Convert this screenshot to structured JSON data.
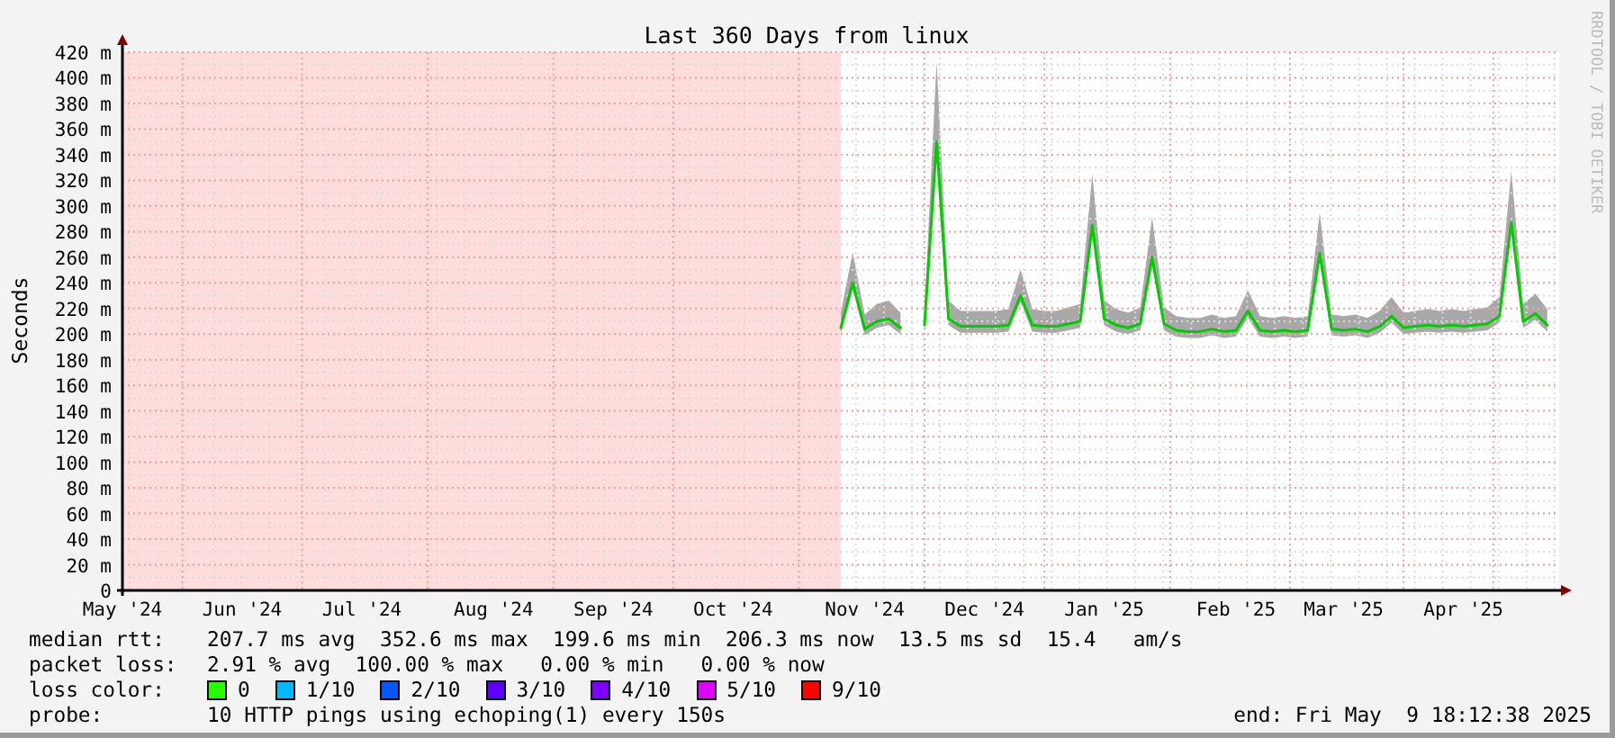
{
  "chart": {
    "watermark": "RRDTOOL / TOBI OETIKER",
    "chart_data": {
      "type": "line",
      "title": "Last 360 Days from linux",
      "ylabel": "Seconds",
      "ylim": [
        0,
        420
      ],
      "yticks": [
        {
          "value": 0,
          "label": "0"
        },
        {
          "value": 20,
          "label": "20 m"
        },
        {
          "value": 40,
          "label": "40 m"
        },
        {
          "value": 60,
          "label": "60 m"
        },
        {
          "value": 80,
          "label": "80 m"
        },
        {
          "value": 100,
          "label": "100 m"
        },
        {
          "value": 120,
          "label": "120 m"
        },
        {
          "value": 140,
          "label": "140 m"
        },
        {
          "value": 160,
          "label": "160 m"
        },
        {
          "value": 180,
          "label": "180 m"
        },
        {
          "value": 200,
          "label": "200 m"
        },
        {
          "value": 220,
          "label": "220 m"
        },
        {
          "value": 240,
          "label": "240 m"
        },
        {
          "value": 260,
          "label": "260 m"
        },
        {
          "value": 280,
          "label": "280 m"
        },
        {
          "value": 300,
          "label": "300 m"
        },
        {
          "value": 320,
          "label": "320 m"
        },
        {
          "value": 340,
          "label": "340 m"
        },
        {
          "value": 360,
          "label": "360 m"
        },
        {
          "value": 380,
          "label": "380 m"
        },
        {
          "value": 400,
          "label": "400 m"
        },
        {
          "value": 420,
          "label": "420 m"
        }
      ],
      "grid": true,
      "categories": [
        "May '24",
        null,
        null,
        null,
        null,
        null,
        null,
        null,
        null,
        null,
        "Jun '24",
        null,
        null,
        null,
        null,
        null,
        null,
        null,
        null,
        null,
        "Jul '24",
        null,
        null,
        null,
        null,
        null,
        null,
        null,
        null,
        null,
        null,
        "Aug '24",
        null,
        null,
        null,
        null,
        null,
        null,
        null,
        null,
        null,
        "Sep '24",
        null,
        null,
        null,
        null,
        null,
        null,
        null,
        null,
        null,
        "Oct '24",
        null,
        null,
        null,
        null,
        null,
        null,
        null,
        null,
        null,
        null,
        "Nov '24",
        null,
        null,
        null,
        null,
        null,
        null,
        null,
        null,
        null,
        "Dec '24",
        null,
        null,
        null,
        null,
        null,
        null,
        null,
        null,
        null,
        "Jan '25",
        null,
        null,
        null,
        null,
        null,
        null,
        null,
        null,
        null,
        null,
        "Feb '25",
        null,
        null,
        null,
        null,
        null,
        null,
        null,
        null,
        "Mar '25",
        null,
        null,
        null,
        null,
        null,
        null,
        null,
        null,
        null,
        "Apr '25",
        null,
        null,
        null,
        null,
        null,
        null,
        null
      ],
      "series": [
        {
          "color": "#00cc00",
          "values": [
            null,
            null,
            null,
            null,
            null,
            null,
            null,
            null,
            null,
            null,
            null,
            null,
            null,
            null,
            null,
            null,
            null,
            null,
            null,
            null,
            null,
            null,
            null,
            null,
            null,
            null,
            null,
            null,
            null,
            null,
            null,
            null,
            null,
            null,
            null,
            null,
            null,
            null,
            null,
            null,
            null,
            null,
            null,
            null,
            null,
            null,
            null,
            null,
            null,
            null,
            null,
            null,
            null,
            null,
            null,
            null,
            null,
            null,
            null,
            null,
            205,
            240,
            204,
            210,
            212,
            205,
            null,
            207,
            350,
            212,
            206,
            206,
            206,
            206,
            207,
            230,
            207,
            206,
            206,
            208,
            210,
            285,
            212,
            207,
            205,
            208,
            260,
            208,
            203,
            202,
            202,
            204,
            202,
            203,
            218,
            203,
            202,
            203,
            202,
            203,
            263,
            204,
            203,
            204,
            202,
            206,
            214,
            205,
            206,
            207,
            206,
            207,
            206,
            207,
            208,
            214,
            287,
            210,
            216,
            207
          ]
        }
      ]
    }
  },
  "legend": [
    {
      "kind": "text",
      "label": "median rtt:",
      "text": "207.7 ms avg  352.6 ms max  199.6 ms min  206.3 ms now  13.5 ms sd  15.4   am/s"
    },
    {
      "kind": "text",
      "label": "packet loss:",
      "text": "2.91 % avg  100.00 % max   0.00 % min   0.00 % now"
    },
    {
      "kind": "swatches",
      "label": "loss color:",
      "swatches": [
        {
          "label": "0",
          "color": "#26ff00"
        },
        {
          "label": "1/10",
          "color": "#00b8ff"
        },
        {
          "label": "2/10",
          "color": "#0059ff"
        },
        {
          "label": "3/10",
          "color": "#5e00ff"
        },
        {
          "label": "4/10",
          "color": "#7e00ff"
        },
        {
          "label": "5/10",
          "color": "#dd00ff"
        },
        {
          "label": "9/10",
          "color": "#ff0000"
        }
      ]
    },
    {
      "kind": "probe",
      "label": "probe:",
      "text": "10 HTTP pings using echoping(1) every 150s",
      "end": "end: Fri May  9 18:12:38 2025"
    }
  ]
}
